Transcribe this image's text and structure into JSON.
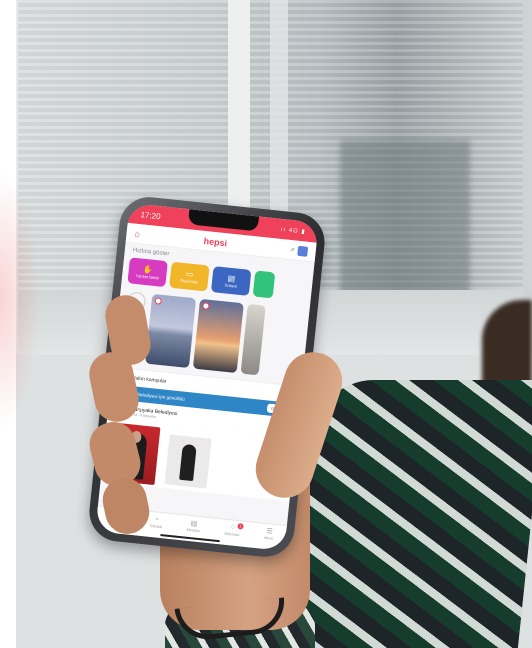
{
  "status": {
    "time": "17:20",
    "icons": "ıı 4G ▮"
  },
  "app": {
    "logo": "hepsi"
  },
  "sections": {
    "quick_title": "Hızlıca göster"
  },
  "quick": [
    {
      "label": "Yardım talebi",
      "color": "#d63bc0"
    },
    {
      "label": "Duyurular",
      "color": "#f2b62a"
    },
    {
      "label": "Sosyal",
      "color": "#3b67c2"
    },
    {
      "label": "",
      "color": "#33c27a"
    }
  ],
  "stories": {
    "add_caption": "Hikâyeni paylaşmak için dokun"
  },
  "rows": {
    "nearby": "Yakın komşular"
  },
  "banner": {
    "text": "Karşıyaka Belediyesi için gönüllülü",
    "button": "Gönüllü ol"
  },
  "post": {
    "author": "Karşıyaka Belediyesi",
    "meta": "1 sa · Karşıyaka"
  },
  "tabs": [
    {
      "label": "Ana Sayfa",
      "icon": "⌂"
    },
    {
      "label": "Topluluk",
      "icon": "◔"
    },
    {
      "label": "Mesajlar",
      "icon": "▤"
    },
    {
      "label": "Bildirimler",
      "icon": "♢",
      "badge": "1"
    },
    {
      "label": "Menü",
      "icon": "☰"
    }
  ],
  "colors": {
    "brand": "#ef4159",
    "banner": "#2f86c7"
  }
}
